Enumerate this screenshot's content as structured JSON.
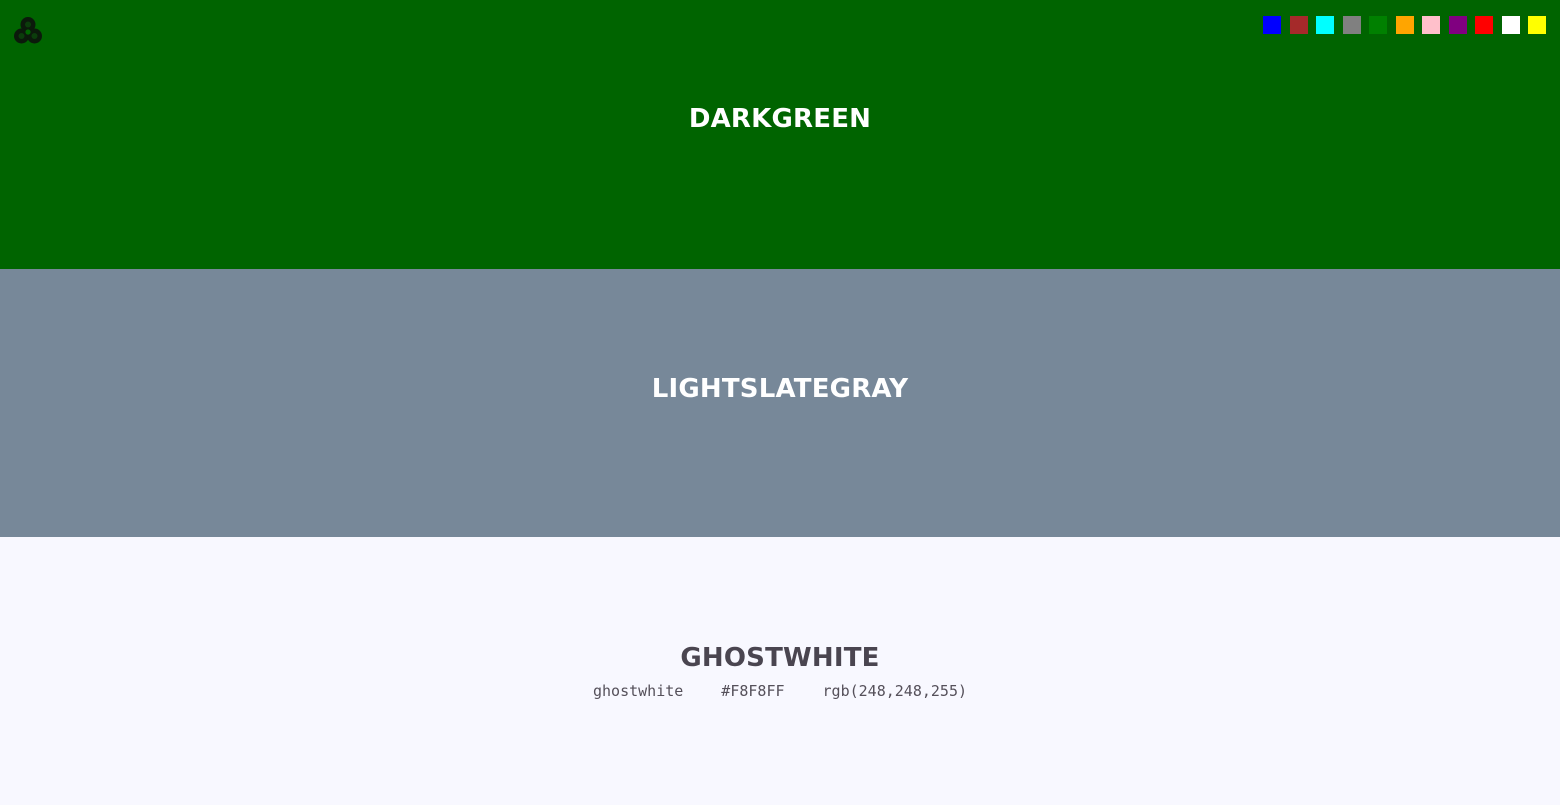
{
  "logo": {
    "icon": "trefoil-logo-icon",
    "color": "#0b1a0b"
  },
  "swatches": [
    {
      "name": "blue",
      "color": "#0000ff"
    },
    {
      "name": "brown",
      "color": "#a52a2a"
    },
    {
      "name": "cyan",
      "color": "#00ffff"
    },
    {
      "name": "gray",
      "color": "#808080"
    },
    {
      "name": "green",
      "color": "#008000"
    },
    {
      "name": "orange",
      "color": "#ffa500"
    },
    {
      "name": "pink",
      "color": "#ffc0cb"
    },
    {
      "name": "purple",
      "color": "#800080"
    },
    {
      "name": "red",
      "color": "#ff0000"
    },
    {
      "name": "white",
      "color": "#ffffff"
    },
    {
      "name": "yellow",
      "color": "#ffff00"
    }
  ],
  "bands": [
    {
      "title": "DARKGREEN",
      "background": "#006400",
      "text_color": "#ffffff"
    },
    {
      "title": "LIGHTSLATEGRAY",
      "background": "#778899",
      "text_color": "#ffffff"
    },
    {
      "title": "GHOSTWHITE",
      "background": "#f8f8ff",
      "text_color": "#4a4550",
      "info": {
        "name": "ghostwhite",
        "hex": "#F8F8FF",
        "rgb": "rgb(248,248,255)"
      }
    }
  ]
}
